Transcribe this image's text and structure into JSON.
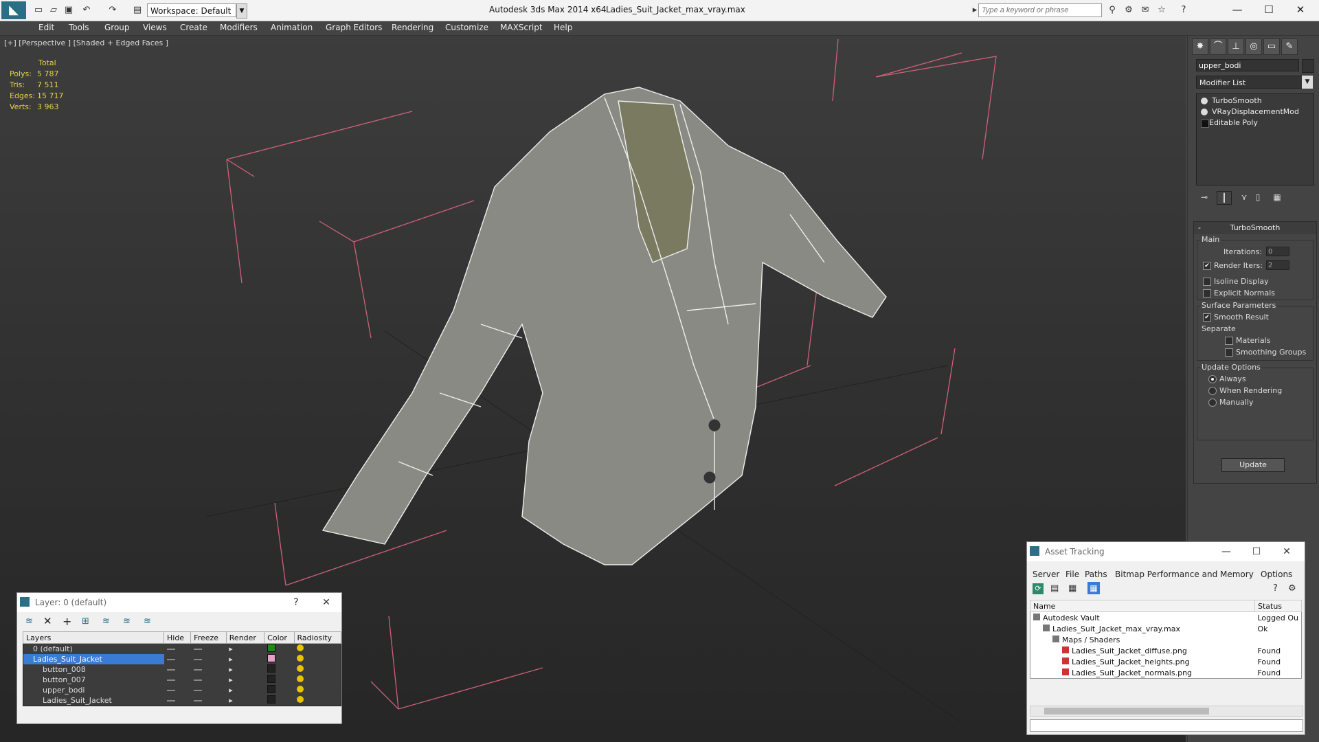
{
  "titlebar": {
    "workspace": "Workspace: Default",
    "app_title": "Autodesk 3ds Max  2014 x64",
    "file_title": "Ladies_Suit_Jacket_max_vray.max",
    "search_placeholder": "Type a keyword or phrase"
  },
  "menu": [
    "Edit",
    "Tools",
    "Group",
    "Views",
    "Create",
    "Modifiers",
    "Animation",
    "Graph Editors",
    "Rendering",
    "Customize",
    "MAXScript",
    "Help"
  ],
  "viewport": {
    "label": "[+] [Perspective ] [Shaded + Edged Faces ]",
    "stats_header": "Total",
    "stats": [
      {
        "label": "Polys:",
        "value": "5 787"
      },
      {
        "label": "Tris:",
        "value": "7 511"
      },
      {
        "label": "Edges:",
        "value": "15 717"
      },
      {
        "label": "Verts:",
        "value": "3 963"
      }
    ]
  },
  "modify_panel": {
    "object_name": "upper_bodi",
    "modifier_list": "Modifier List",
    "stack": [
      "TurboSmooth",
      "VRayDisplacementMod",
      "Editable Poly"
    ],
    "turbosmooth": {
      "title": "TurboSmooth",
      "main_label": "Main",
      "iterations_label": "Iterations:",
      "iterations_value": "0",
      "render_iters_label": "Render Iters:",
      "render_iters_value": "2",
      "isoline_label": "Isoline Display",
      "explicit_normals_label": "Explicit Normals",
      "surface_params_label": "Surface Parameters",
      "smooth_result_label": "Smooth Result",
      "separate_label": "Separate",
      "materials_label": "Materials",
      "smoothing_groups_label": "Smoothing Groups",
      "update_options_label": "Update Options",
      "always_label": "Always",
      "when_rendering_label": "When Rendering",
      "manually_label": "Manually",
      "update_button": "Update"
    }
  },
  "layer_dialog": {
    "title": "Layer: 0 (default)",
    "help": "?",
    "columns": [
      "Layers",
      "Hide",
      "Freeze",
      "Render",
      "Color",
      "Radiosity"
    ],
    "rows": [
      {
        "name": "0 (default)",
        "color": "#1a8a1a",
        "indent": 1,
        "selected": false
      },
      {
        "name": "Ladies_Suit_Jacket",
        "color": "#e8a0c8",
        "indent": 1,
        "selected": true
      },
      {
        "name": "button_008",
        "color": "#222222",
        "indent": 2,
        "selected": false
      },
      {
        "name": "button_007",
        "color": "#222222",
        "indent": 2,
        "selected": false
      },
      {
        "name": "upper_bodi",
        "color": "#222222",
        "indent": 2,
        "selected": false
      },
      {
        "name": "Ladies_Suit_Jacket",
        "color": "#222222",
        "indent": 2,
        "selected": false
      }
    ]
  },
  "asset_dialog": {
    "title": "Asset Tracking",
    "menu": [
      "Server",
      "File",
      "Paths",
      "Bitmap Performance and Memory",
      "Options"
    ],
    "columns": [
      "Name",
      "Status"
    ],
    "rows": [
      {
        "name": "Autodesk Vault",
        "status": "Logged Ou",
        "indent": 1
      },
      {
        "name": "Ladies_Suit_Jacket_max_vray.max",
        "status": "Ok",
        "indent": 2
      },
      {
        "name": "Maps / Shaders",
        "status": "",
        "indent": 3
      },
      {
        "name": "Ladies_Suit_Jacket_diffuse.png",
        "status": "Found",
        "indent": 4
      },
      {
        "name": "Ladies_Suit_Jacket_heights.png",
        "status": "Found",
        "indent": 4
      },
      {
        "name": "Ladies_Suit_Jacket_normals.png",
        "status": "Found",
        "indent": 4
      }
    ]
  }
}
